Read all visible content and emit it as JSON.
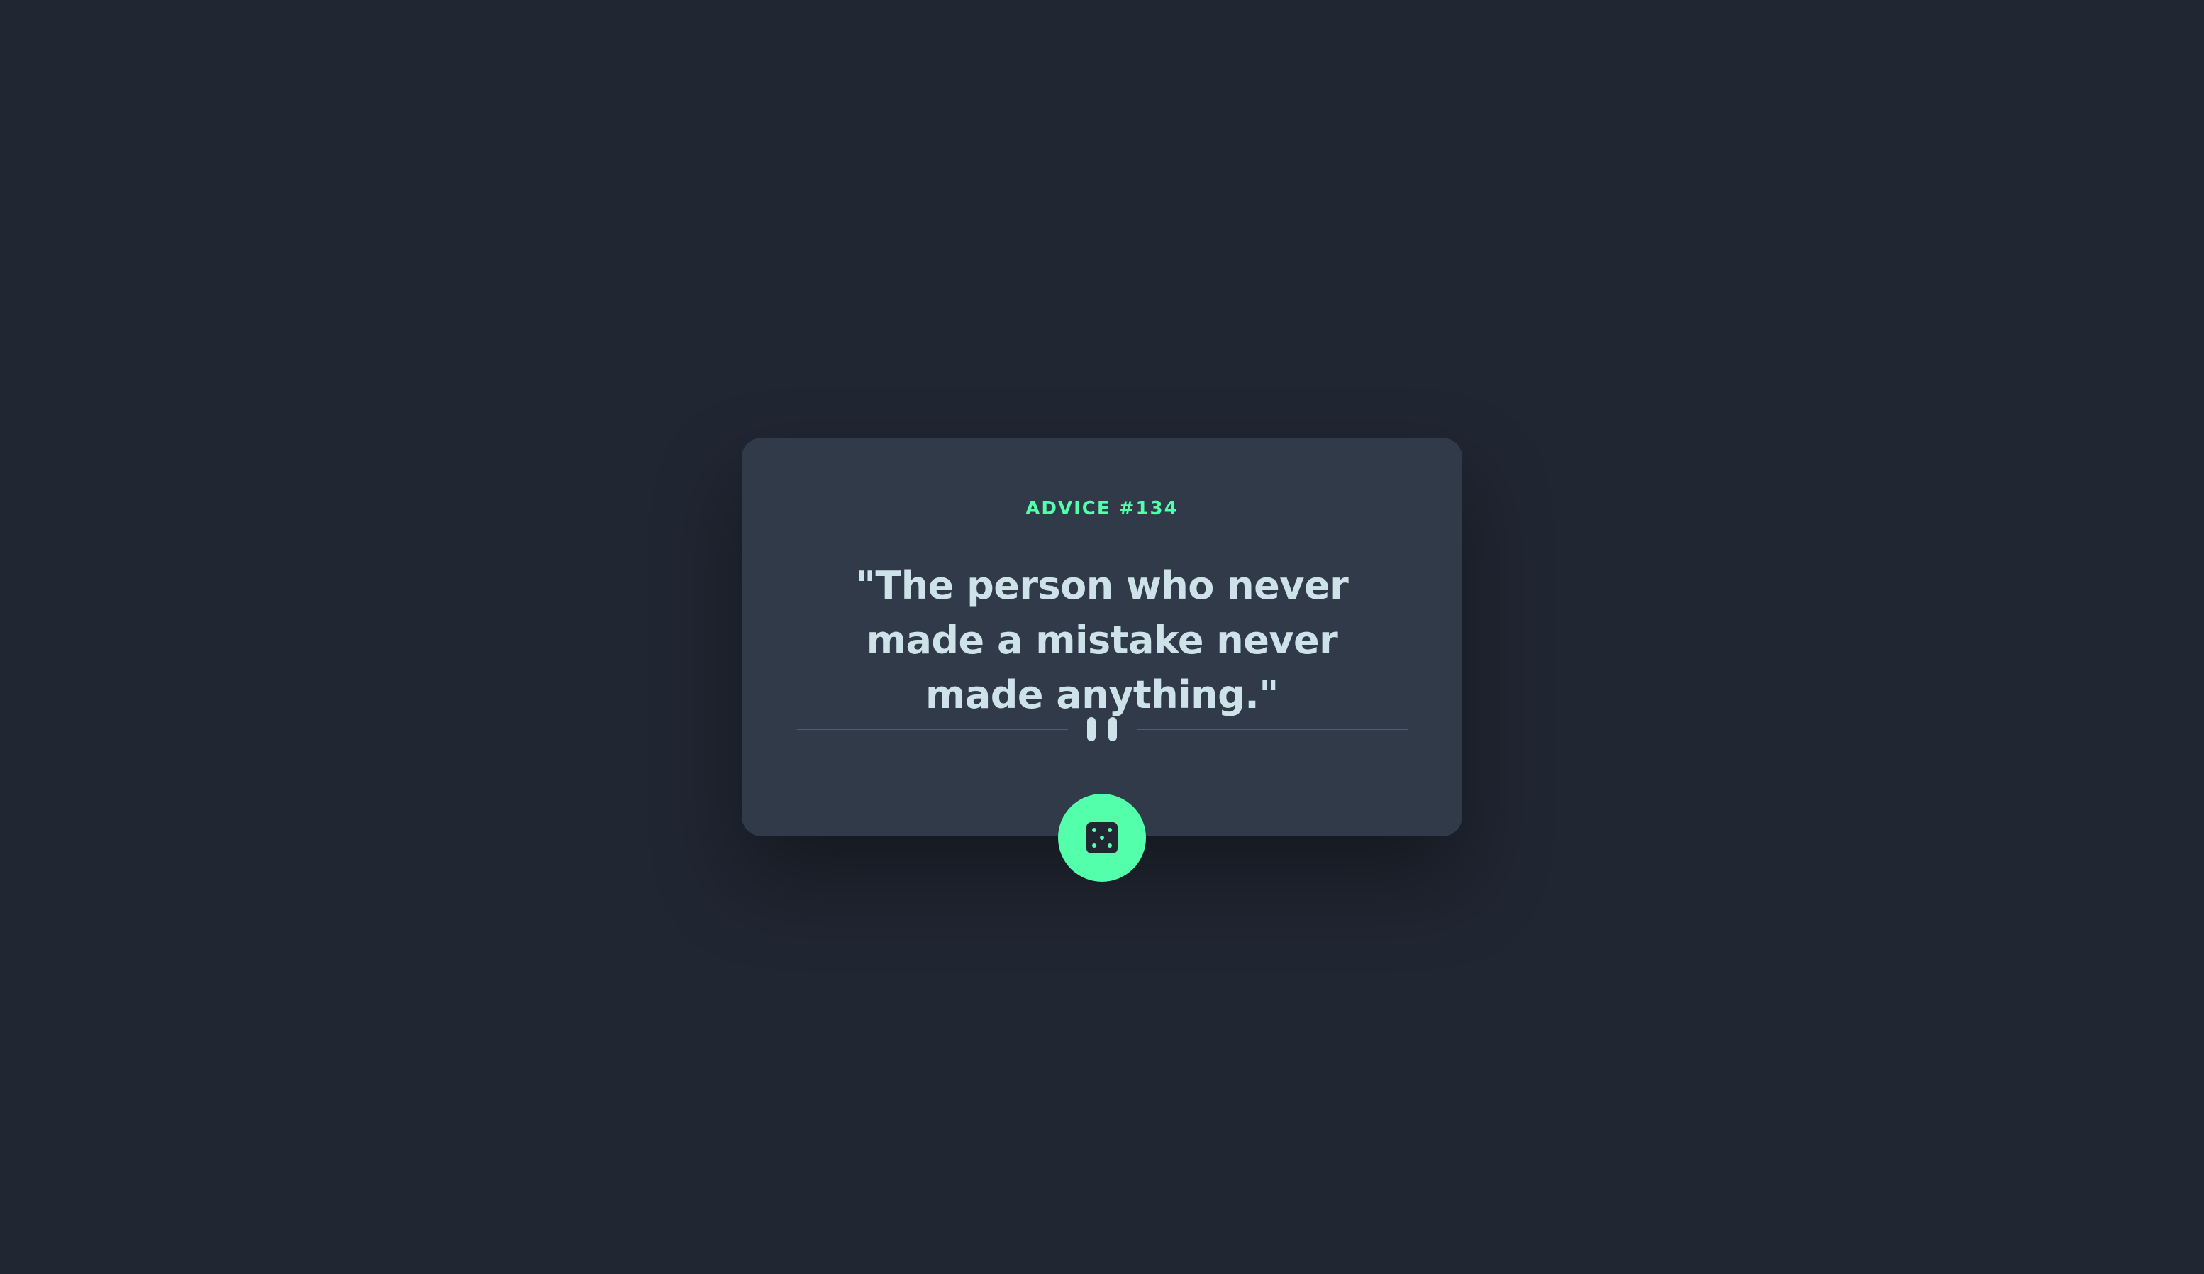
{
  "advice": {
    "label": "ADVICE #134",
    "quote": "\"The person who never made a mistake never made anything.\""
  },
  "button": {
    "icon": "dice-icon",
    "accent_color": "#53ffaa"
  },
  "divider": {
    "icon": "pause-icon"
  },
  "colors": {
    "background": "#202632",
    "card": "#313a49",
    "text": "#cee3e9",
    "accent": "#53ffaa"
  }
}
